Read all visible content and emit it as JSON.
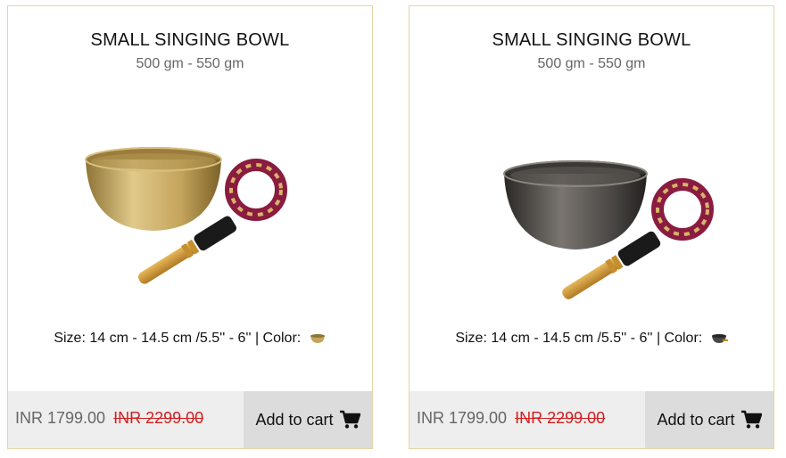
{
  "products": [
    {
      "title": "SMALL SINGING BOWL",
      "weight": "500 gm - 550 gm",
      "size_text": "Size: 14 cm - 14.5 cm /5.5'' - 6'' | Color:",
      "color_icon": "gold-bowl-icon",
      "price": "INR 1799.00",
      "old_price": "INR 2299.00",
      "cart_label": "Add to cart",
      "bowl_color": "#c5a55a"
    },
    {
      "title": "SMALL SINGING BOWL",
      "weight": "500 gm - 550 gm",
      "size_text": "Size: 14 cm - 14.5 cm /5.5'' - 6'' | Color:",
      "color_icon": "black-bowl-icon",
      "price": "INR 1799.00",
      "old_price": "INR 2299.00",
      "cart_label": "Add to cart",
      "bowl_color": "#4a4845"
    }
  ],
  "colors": {
    "border": "#e6d3a6",
    "old_price": "#d21e1e",
    "footer_bg": "#eeeeee",
    "button_bg": "#dcdcdc"
  }
}
